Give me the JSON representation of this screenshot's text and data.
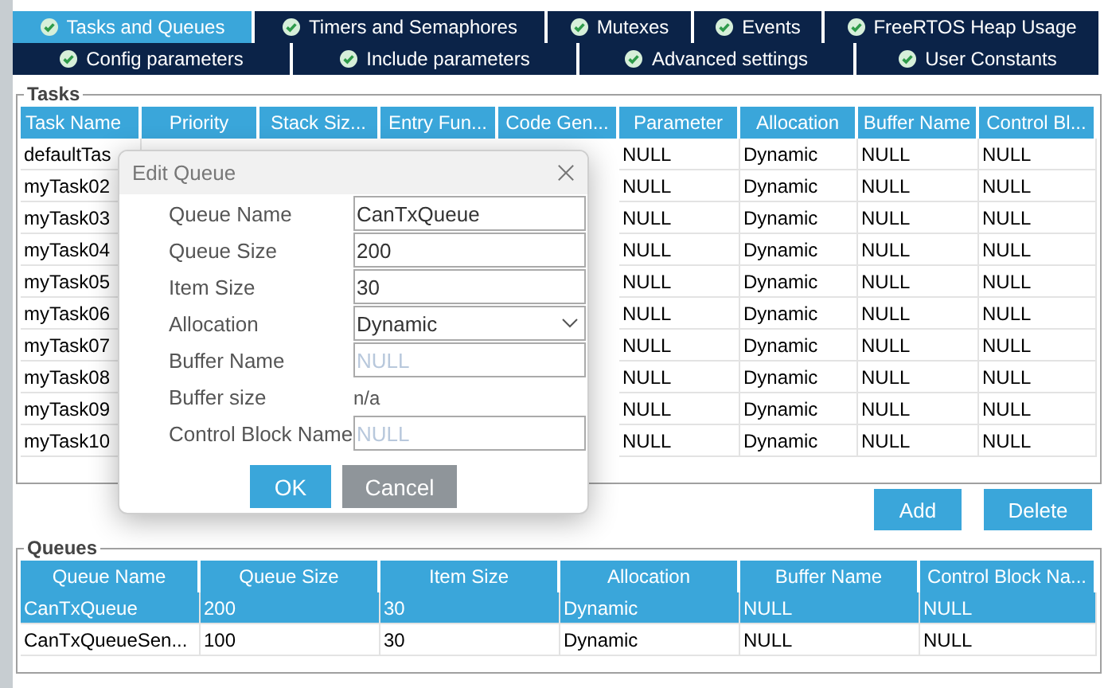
{
  "tab_rows": [
    [
      {
        "label": "Tasks and Queues",
        "selected": true
      },
      {
        "label": "Timers and Semaphores",
        "selected": false
      },
      {
        "label": "Mutexes",
        "selected": false
      },
      {
        "label": "Events",
        "selected": false
      },
      {
        "label": "FreeRTOS Heap Usage",
        "selected": false
      }
    ],
    [
      {
        "label": "Config parameters",
        "selected": false
      },
      {
        "label": "Include parameters",
        "selected": false
      },
      {
        "label": "Advanced settings",
        "selected": false
      },
      {
        "label": "User Constants",
        "selected": false
      }
    ]
  ],
  "tasks": {
    "title": "Tasks",
    "columns": [
      "Task Name",
      "Priority",
      "Stack Siz...",
      "Entry Fun...",
      "Code Gen...",
      "Parameter",
      "Allocation",
      "Buffer Name",
      "Control Bl..."
    ],
    "rows": [
      {
        "name": "defaultTas",
        "parameter": "NULL",
        "allocation": "Dynamic",
        "buffer_name": "NULL",
        "control_block": "NULL"
      },
      {
        "name": "myTask02",
        "parameter": "NULL",
        "allocation": "Dynamic",
        "buffer_name": "NULL",
        "control_block": "NULL"
      },
      {
        "name": "myTask03",
        "parameter": "NULL",
        "allocation": "Dynamic",
        "buffer_name": "NULL",
        "control_block": "NULL"
      },
      {
        "name": "myTask04",
        "parameter": "NULL",
        "allocation": "Dynamic",
        "buffer_name": "NULL",
        "control_block": "NULL"
      },
      {
        "name": "myTask05",
        "parameter": "NULL",
        "allocation": "Dynamic",
        "buffer_name": "NULL",
        "control_block": "NULL"
      },
      {
        "name": "myTask06",
        "parameter": "NULL",
        "allocation": "Dynamic",
        "buffer_name": "NULL",
        "control_block": "NULL"
      },
      {
        "name": "myTask07",
        "parameter": "NULL",
        "allocation": "Dynamic",
        "buffer_name": "NULL",
        "control_block": "NULL"
      },
      {
        "name": "myTask08",
        "parameter": "NULL",
        "allocation": "Dynamic",
        "buffer_name": "NULL",
        "control_block": "NULL"
      },
      {
        "name": "myTask09",
        "parameter": "NULL",
        "allocation": "Dynamic",
        "buffer_name": "NULL",
        "control_block": "NULL"
      },
      {
        "name": "myTask10",
        "parameter": "NULL",
        "allocation": "Dynamic",
        "buffer_name": "NULL",
        "control_block": "NULL"
      }
    ],
    "buttons": [
      "Add",
      "Delete"
    ]
  },
  "queues": {
    "title": "Queues",
    "columns": [
      "Queue Name",
      "Queue Size",
      "Item Size",
      "Allocation",
      "Buffer Name",
      "Control Block Na..."
    ],
    "rows": [
      {
        "selected": true,
        "cells": [
          "CanTxQueue",
          "200",
          "30",
          "Dynamic",
          "NULL",
          "NULL"
        ]
      },
      {
        "selected": false,
        "cells": [
          "CanTxQueueSen...",
          "100",
          "30",
          "Dynamic",
          "NULL",
          "NULL"
        ]
      }
    ]
  },
  "dialog": {
    "title": "Edit Queue",
    "fields": [
      {
        "kind": "text",
        "label": "Queue Name",
        "value": "CanTxQueue"
      },
      {
        "kind": "text",
        "label": "Queue Size",
        "value": "200"
      },
      {
        "kind": "text",
        "label": "Item Size",
        "value": "30"
      },
      {
        "kind": "dropdown",
        "label": "Allocation",
        "value": "Dynamic"
      },
      {
        "kind": "text",
        "label": "Buffer Name",
        "placeholder": "NULL"
      },
      {
        "kind": "readonly",
        "label": "Buffer size",
        "value": "n/a"
      },
      {
        "kind": "text",
        "label": "Control Block Name",
        "placeholder": "NULL"
      }
    ],
    "buttons": [
      {
        "kind": "primary",
        "label": "OK"
      },
      {
        "kind": "secondary",
        "label": "Cancel"
      }
    ]
  }
}
